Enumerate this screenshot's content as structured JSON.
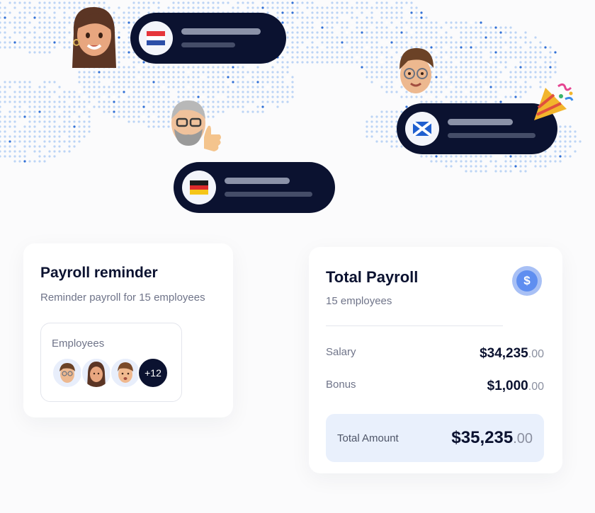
{
  "background": {
    "map": "world-dot-map",
    "dot_color": "#bcd4f5",
    "accent_dot_color": "#2f6fd6"
  },
  "floating_cards": [
    {
      "flag_icon": "netherlands-flag-icon",
      "avatar_icon": "woman-avatar-icon"
    },
    {
      "flag_icon": "scotland-flag-icon",
      "avatar_icon": "man-glasses-avatar-icon",
      "decoration_icon": "party-popper-icon"
    },
    {
      "flag_icon": "germany-flag-icon",
      "avatar_icon": "older-man-thumbs-up-avatar-icon"
    }
  ],
  "payroll_reminder": {
    "title": "Payroll reminder",
    "subtitle": "Reminder payroll for 15 employees",
    "employees_label": "Employees",
    "more_count": "+12"
  },
  "total_payroll": {
    "title": "Total Payroll",
    "subtitle": "15 employees",
    "coin_symbol": "$",
    "salary_label": "Salary",
    "salary_main": "$34,235",
    "salary_cents": ".00",
    "bonus_label": "Bonus",
    "bonus_main": "$1,000",
    "bonus_cents": ".00",
    "total_label": "Total Amount",
    "total_main": "$35,235",
    "total_cents": ".00"
  },
  "colors": {
    "navy": "#0b1230",
    "accent_blue": "#5f8ef0",
    "light_blue": "#e9f0fc"
  }
}
